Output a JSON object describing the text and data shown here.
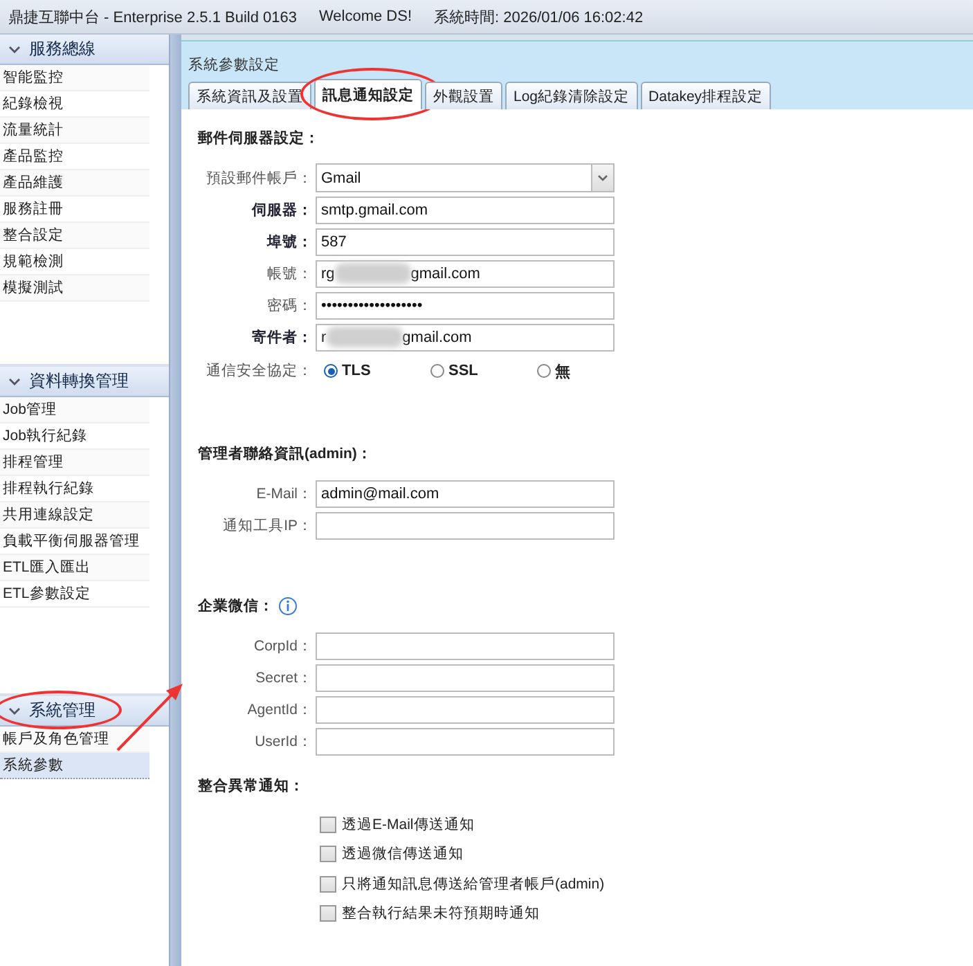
{
  "titlebar": {
    "app": "鼎捷互聯中台 - Enterprise 2.5.1 Build 0163",
    "welcome": "Welcome DS!",
    "clock": "系統時間: 2026/01/06 16:02:42"
  },
  "sidebar": [
    {
      "title": "服務總線",
      "circled": false,
      "items": [
        {
          "label": "智能監控",
          "selected": false
        },
        {
          "label": "紀錄檢視",
          "selected": false
        },
        {
          "label": "流量統計",
          "selected": false
        },
        {
          "label": "產品監控",
          "selected": false
        },
        {
          "label": "產品維護",
          "selected": false
        },
        {
          "label": "服務註冊",
          "selected": false
        },
        {
          "label": "整合設定",
          "selected": false
        },
        {
          "label": "規範檢測",
          "selected": false
        },
        {
          "label": "模擬測試",
          "selected": false
        }
      ]
    },
    {
      "title": "資料轉換管理",
      "circled": false,
      "items": [
        {
          "label": "Job管理",
          "selected": false
        },
        {
          "label": "Job執行紀錄",
          "selected": false
        },
        {
          "label": "排程管理",
          "selected": false
        },
        {
          "label": "排程執行紀錄",
          "selected": false
        },
        {
          "label": "共用連線設定",
          "selected": false
        },
        {
          "label": "負載平衡伺服器管理",
          "selected": false
        },
        {
          "label": "ETL匯入匯出",
          "selected": false
        },
        {
          "label": "ETL參數設定",
          "selected": false
        }
      ]
    },
    {
      "title": "系統管理",
      "circled": true,
      "items": [
        {
          "label": "帳戶及角色管理",
          "selected": false
        },
        {
          "label": "系統參數",
          "selected": true
        }
      ]
    }
  ],
  "pointer_arrow": true,
  "panel": {
    "title": "系統參數設定",
    "tabs": [
      {
        "label": "系統資訊及設置",
        "selected": false,
        "circled": false
      },
      {
        "label": "訊息通知設定",
        "selected": true,
        "circled": true
      },
      {
        "label": "外觀設置",
        "selected": false,
        "circled": false
      },
      {
        "label": "Log紀錄清除設定",
        "selected": false,
        "circled": false
      },
      {
        "label": "Datakey排程設定",
        "selected": false,
        "circled": false
      }
    ],
    "sections": [
      {
        "title": "郵件伺服器設定：",
        "fields": [
          {
            "kind": "select",
            "label": "預設郵件帳戶：",
            "required": false,
            "value": "Gmail"
          },
          {
            "kind": "text",
            "label": "伺服器：",
            "required": true,
            "value": "smtp.gmail.com"
          },
          {
            "kind": "text",
            "label": "埠號：",
            "required": true,
            "value": "587"
          },
          {
            "kind": "blurred",
            "label": "帳號：",
            "required": false,
            "value": "rg",
            "value_end": "gmail.com"
          },
          {
            "kind": "text",
            "label": "密碼：",
            "required": false,
            "value": "•••••••••••••••••••"
          },
          {
            "kind": "blurred",
            "label": "寄件者：",
            "required": true,
            "value": "r",
            "value_end": "gmail.com"
          },
          {
            "kind": "radio",
            "label": "通信安全協定：",
            "required": false,
            "options": [
              {
                "label": "TLS",
                "selected": true
              },
              {
                "label": "SSL",
                "selected": false
              },
              {
                "label": "無",
                "selected": false
              }
            ]
          }
        ]
      },
      {
        "title": "管理者聯絡資訊(admin)：",
        "fields": [
          {
            "kind": "text",
            "label": "E-Mail：",
            "required": false,
            "value": "admin@mail.com"
          },
          {
            "kind": "text",
            "label": "通知工具IP：",
            "required": false
          }
        ]
      },
      {
        "title": "企業微信：",
        "info": true,
        "fields": [
          {
            "kind": "text",
            "label": "CorpId：",
            "required": false
          },
          {
            "kind": "text",
            "label": "Secret：",
            "required": false
          },
          {
            "kind": "text",
            "label": "AgentId：",
            "required": false
          },
          {
            "kind": "text",
            "label": "UserId：",
            "required": false
          }
        ]
      },
      {
        "title": "整合異常通知：",
        "checks": [
          {
            "label": "透過E-Mail傳送通知",
            "checked": false
          },
          {
            "label": "透過微信傳送通知",
            "checked": false
          },
          {
            "label": "只將通知訊息傳送給管理者帳戶(admin)",
            "checked": false
          },
          {
            "label": "整合執行結果未符預期時通知",
            "checked": false
          }
        ]
      }
    ]
  }
}
